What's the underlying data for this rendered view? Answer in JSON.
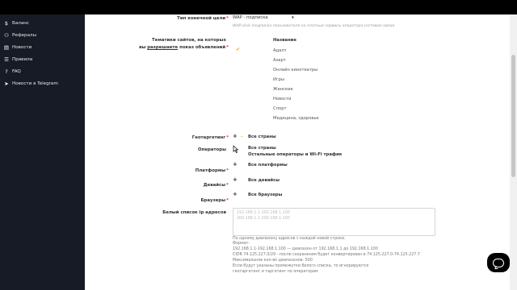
{
  "sidebar": {
    "items": [
      {
        "label": "Баланс",
        "icon": "dollar-icon",
        "glyph": "$"
      },
      {
        "label": "Рефералы",
        "icon": "users-icon",
        "glyph": "⚇"
      },
      {
        "label": "Новости",
        "icon": "newspaper-icon",
        "glyph": "▤"
      },
      {
        "label": "Правила",
        "icon": "rules-icon",
        "glyph": "☰"
      },
      {
        "label": "FAQ",
        "icon": "question-icon",
        "glyph": "?"
      },
      {
        "label": "Новости в Telegram",
        "icon": "telegram-icon",
        "glyph": "➤"
      }
    ]
  },
  "form": {
    "end_target": {
      "label": "Тип конечной цели",
      "value": "WAP - подписка",
      "hint": "WAP-click (подписка пользователя на платные сервисы оператора (сотовой связи)"
    },
    "topics": {
      "label_line1": "Тематики сайтов, на которых",
      "label_line2_prefix": "вы ",
      "label_line2_underlined": "разрешаете",
      "label_line2_suffix": " показ объявлений",
      "column_header": "Название",
      "items": [
        "Адалт",
        "Азарт",
        "Онлайн кинотеатры",
        "Игры",
        "Женские",
        "Новости",
        "Спорт",
        "Медицина, здоровье"
      ]
    },
    "geotargeting": {
      "label": "Геотаргетинг",
      "value": "Все страны"
    },
    "operators": {
      "label": "Операторы",
      "value": "Все страны",
      "value2": "Остальные операторы и Wi-Fi трафик"
    },
    "platforms": {
      "label": "Платформы",
      "value": "Все платформы"
    },
    "devices": {
      "label": "Девайсы",
      "value": "Все девайсы"
    },
    "browsers": {
      "label": "Браузеры",
      "value": "Все браузеры"
    },
    "ip_whitelist": {
      "label": "Белый список ip адресов",
      "placeholder": "192.168.1.1-192.168.1.100\n200.168.1.1-200.168.1.100",
      "notes": [
        "По одному диапазону адресов с каждой новой строки.",
        "Формат:",
        "192.168.1.1-192.168.1.100 — диапазон от 192.168.1.1 до 192.168.1.100",
        "CIDR 74.125.227.0/29 - после сохранения будет конвертирован в 74.125.227.0-74.125.227.7",
        "Максимальное кол-во диапазонов: 500",
        "Если будут указаны промежутки белого списка, то игнорируются",
        "геотаргетинг и таргетинг по операторам"
      ]
    }
  },
  "required_mark": "*",
  "plus_glyph": "+",
  "check_glyph": "✔",
  "colors": {
    "sidebar_bg": "#161b26",
    "required": "#e53b2c",
    "check": "#e8a000"
  }
}
